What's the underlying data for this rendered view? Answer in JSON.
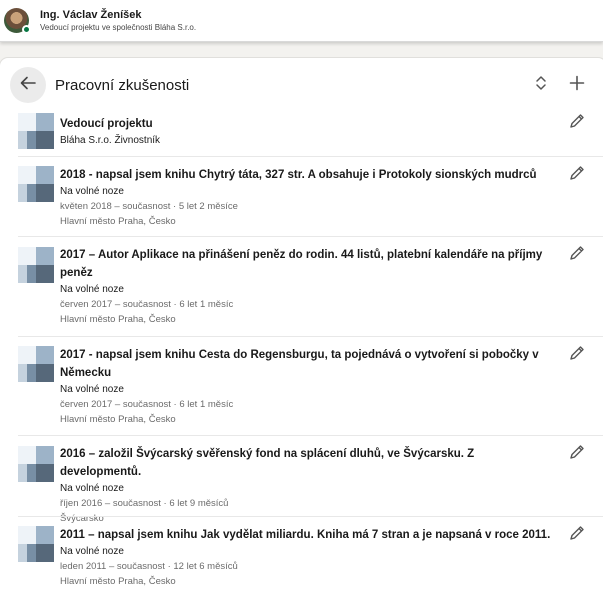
{
  "profile": {
    "name": "Ing. Václav Ženíšek",
    "headline": "Vedoucí projektu ve společnosti Bláha S.r.o."
  },
  "section": {
    "title": "Pracovní zkušenosti",
    "back_icon": "arrow-left-icon",
    "reorder_icon": "reorder-icon",
    "add_icon": "plus-icon",
    "edit_icon": "pencil-icon"
  },
  "experiences": [
    {
      "title": "Vedoucí projektu",
      "company": "Bláha S.r.o. Živnostník"
    },
    {
      "title": "2018 - napsal jsem knihu Chytrý táta, 327 str. A obsahuje i Protokoly sionských mudrců",
      "company": "Na volné noze",
      "dates": "květen 2018 – současnost · 5 let 2 měsíce",
      "location": "Hlavní město Praha, Česko"
    },
    {
      "title_line1": "2017 – Autor Aplikace na přinášení peněz do rodin. 44 listů, platební kalendáře na příjmy",
      "title_line2": "peněz",
      "company": "Na volné noze",
      "dates": "červen 2017 – současnost · 6 let 1 měsíc",
      "location": "Hlavní město Praha, Česko"
    },
    {
      "title_line1": "2017 - napsal jsem knihu Cesta do Regensburgu, ta pojednává o vytvoření si pobočky v",
      "title_line2": "Německu",
      "company": "Na volné noze",
      "dates": "červen 2017 – současnost · 6 let 1 měsíc",
      "location": "Hlavní město Praha, Česko"
    },
    {
      "title": "2016 – založil Švýcarský svěřenský fond na splácení dluhů, ve Švýcarsku. Z developmentů.",
      "company": "Na volné noze",
      "dates": "říjen 2016 – současnost · 6 let 9 měsíců",
      "location": "Švýcarsko"
    },
    {
      "title": "2011 – napsal jsem knihu Jak vydělat miliardu. Kniha má 7 stran a je napsaná v roce 2011.",
      "company": "Na volné noze",
      "dates": "leden 2011 – současnost · 12 let 6 měsíců",
      "location": "Hlavní město Praha, Česko"
    }
  ]
}
